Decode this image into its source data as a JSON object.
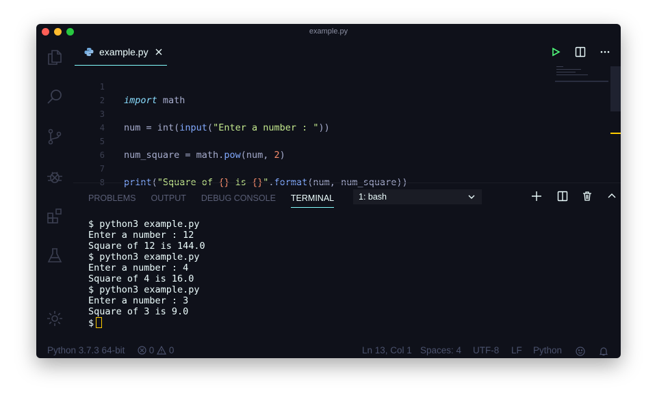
{
  "window": {
    "title": "example.py"
  },
  "activity_bar": [
    "files-icon",
    "search-icon",
    "source-control-icon",
    "debug-icon",
    "extensions-icon",
    "test-flask-icon",
    "settings-gear-icon"
  ],
  "editor": {
    "tab": {
      "name": "example.py"
    },
    "lines": [
      {
        "n": "1",
        "kind": "import"
      },
      {
        "n": "2",
        "kind": "empty"
      },
      {
        "n": "3",
        "kind": "input"
      },
      {
        "n": "4",
        "kind": "empty"
      },
      {
        "n": "5",
        "kind": "pow"
      },
      {
        "n": "6",
        "kind": "empty"
      },
      {
        "n": "7",
        "kind": "print"
      },
      {
        "n": "8",
        "kind": "empty"
      }
    ],
    "code": {
      "l1_kw": "import",
      "l1_rest": " math",
      "l3_a": "num = int(",
      "l3_fn": "input",
      "l3_b": "(",
      "l3_str": "\"Enter a number : \"",
      "l3_c": "))",
      "l5_a": "num_square = math.",
      "l5_fn": "pow",
      "l5_b": "(num, ",
      "l5_num": "2",
      "l5_c": ")",
      "l7_fn": "print",
      "l7_b": "(",
      "l7_s1": "\"Square of ",
      "l7_br1": "{}",
      "l7_s2": " is ",
      "l7_br2": "{}",
      "l7_s3": "\"",
      "l7_c": ".",
      "l7_fn2": "format",
      "l7_d": "(num, num_square))"
    }
  },
  "panel": {
    "tabs": [
      "PROBLEMS",
      "OUTPUT",
      "DEBUG CONSOLE",
      "TERMINAL"
    ],
    "active_tab": "TERMINAL",
    "terminal_select": "1: bash",
    "terminal_lines": [
      "$ python3 example.py",
      "Enter a number : 12",
      "Square of 12 is 144.0",
      "$ python3 example.py",
      "Enter a number : 4",
      "Square of 4 is 16.0",
      "$ python3 example.py",
      "Enter a number : 3",
      "Square of 3 is 9.0"
    ],
    "prompt": "$"
  },
  "status_bar": {
    "python": "Python 3.7.3 64-bit",
    "errors": "0",
    "warnings": "0",
    "position": "Ln 13, Col 1",
    "spaces": "Spaces: 4",
    "encoding": "UTF-8",
    "eol": "LF",
    "language": "Python"
  },
  "colors": {
    "background": "#0f111a",
    "accent": "#84ffff",
    "cursor": "#ffcc00",
    "run_icon": "#50fa7b"
  }
}
